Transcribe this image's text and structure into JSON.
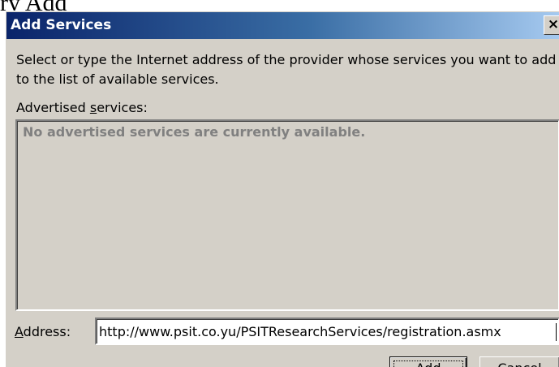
{
  "background_text": "ry Add",
  "dialog": {
    "title": "Add Services",
    "close_glyph": "×",
    "description": "Select or type the Internet address of the provider whose services you want to add to the list of available services.",
    "advertised_label": {
      "before": "Advertised ",
      "mnemonic": "s",
      "after": "ervices:"
    },
    "advertised_empty_text": "No advertised services are currently available.",
    "address_label": {
      "before": "",
      "mnemonic": "A",
      "after": "ddress:"
    },
    "address_value": "http://www.psit.co.yu/PSITResearchServices/registration.asmx",
    "add_button": {
      "before": "A",
      "mnemonic": "d",
      "after": "d"
    },
    "cancel_button": "Cancel"
  },
  "colors": {
    "title_gradient_start": "#0a246a",
    "title_gradient_end": "#a6caf0",
    "dialog_face": "#d4d0c8",
    "disabled_text": "#808080"
  }
}
